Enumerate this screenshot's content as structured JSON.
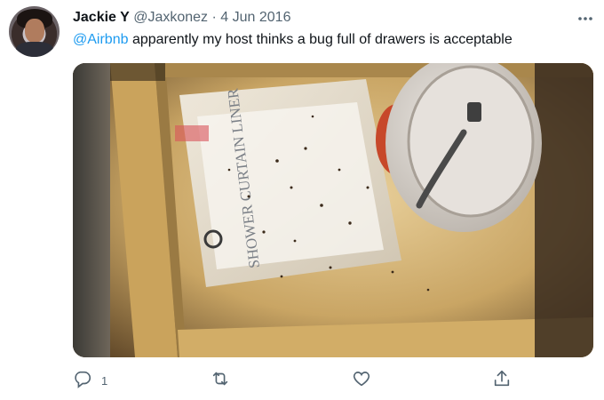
{
  "tweet": {
    "author": {
      "display_name": "Jackie Y",
      "handle": "@Jaxkonez",
      "separator": "·",
      "date": "4 Jun 2016",
      "avatar_icon": "profile-photo"
    },
    "more_icon": "ellipsis-icon",
    "body": {
      "mention": "@Airbnb",
      "text": " apparently my host thinks a bug full of drawers is acceptable"
    },
    "media": {
      "type": "photo",
      "package_text": "SHOWER CURTAIN LINER"
    },
    "actions": {
      "reply": {
        "icon": "reply-icon",
        "count": "1"
      },
      "retweet": {
        "icon": "retweet-icon",
        "count": ""
      },
      "like": {
        "icon": "heart-icon",
        "count": ""
      },
      "share": {
        "icon": "share-icon",
        "count": ""
      }
    },
    "colors": {
      "accent": "#1d9bf0",
      "text": "#0f1419",
      "secondary": "#536471"
    }
  }
}
